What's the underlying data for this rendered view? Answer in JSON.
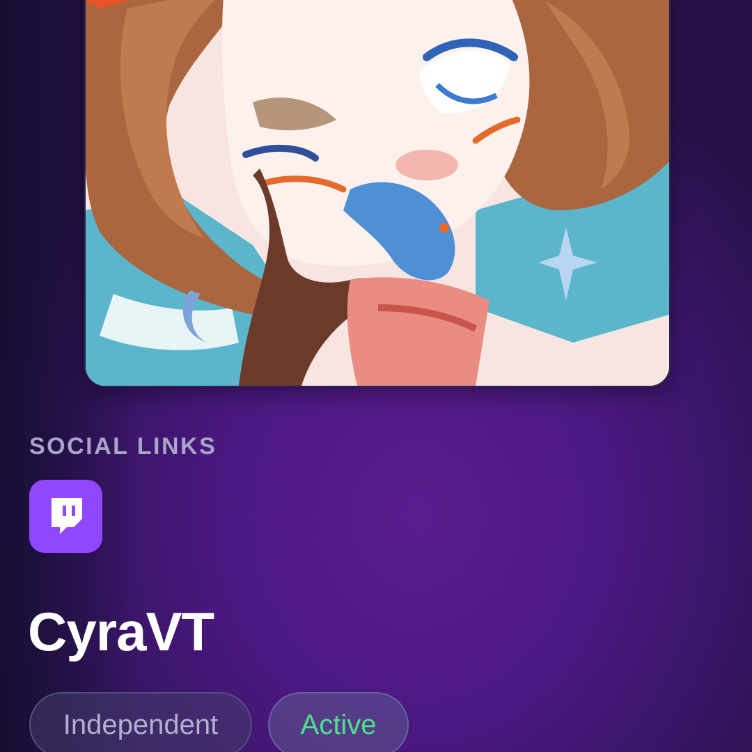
{
  "profile": {
    "display_name": "CyraVT",
    "avatar_icon": "character-artwork"
  },
  "social": {
    "section_label": "SOCIAL LINKS",
    "links": [
      {
        "platform_icon": "twitch-icon",
        "color": "#9146ff"
      }
    ]
  },
  "tags": {
    "affiliation": "Independent",
    "status": "Active",
    "status_color": "#4fe08a"
  }
}
